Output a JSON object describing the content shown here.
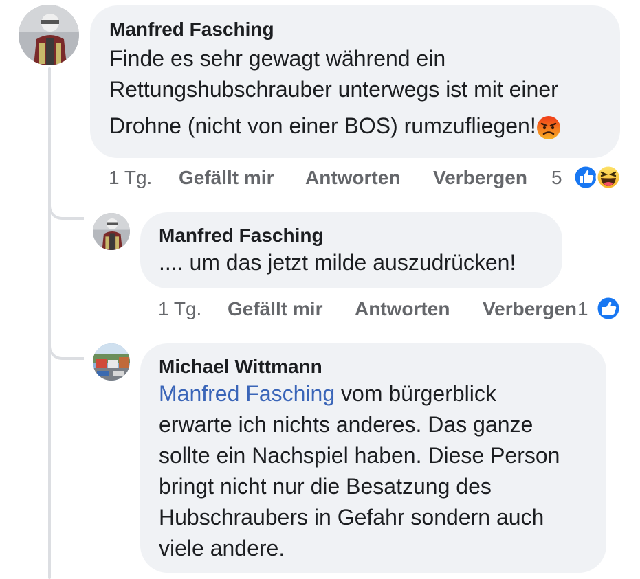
{
  "comments": [
    {
      "author": "Manfred Fasching",
      "text_lines": [
        "Finde es sehr gewagt während ein",
        "Rettungshubschrauber unterwegs ist mit einer",
        "Drohne (nicht von einer BOS) rumzufliegen!"
      ],
      "time": "1 Tg.",
      "like_label": "Gefällt mir",
      "reply_label": "Antworten",
      "hide_label": "Verbergen",
      "reaction_count": "5",
      "reactions": [
        "like-icon",
        "haha-icon"
      ],
      "emoji": "angry-face-icon"
    },
    {
      "author": "Manfred Fasching",
      "text": ".... um das jetzt milde auszudrücken!",
      "time": "1 Tg.",
      "like_label": "Gefällt mir",
      "reply_label": "Antworten",
      "hide_label": "Verbergen",
      "reaction_count": "1",
      "reactions": [
        "like-icon"
      ]
    },
    {
      "author": "Michael Wittmann",
      "mention": "Manfred Fasching",
      "text_first": " vom bürgerblick",
      "text_lines": [
        "erwarte ich nichts anderes. Das ganze",
        "sollte ein Nachspiel haben. Diese Person",
        "bringt nicht nur die Besatzung des",
        "Hubschraubers in Gefahr sondern auch",
        "viele andere."
      ]
    }
  ],
  "colors": {
    "bubble": "#f0f2f5",
    "like_blue": "#1877f2",
    "mention": "#3a65b8",
    "meta_gray": "#65676b"
  }
}
